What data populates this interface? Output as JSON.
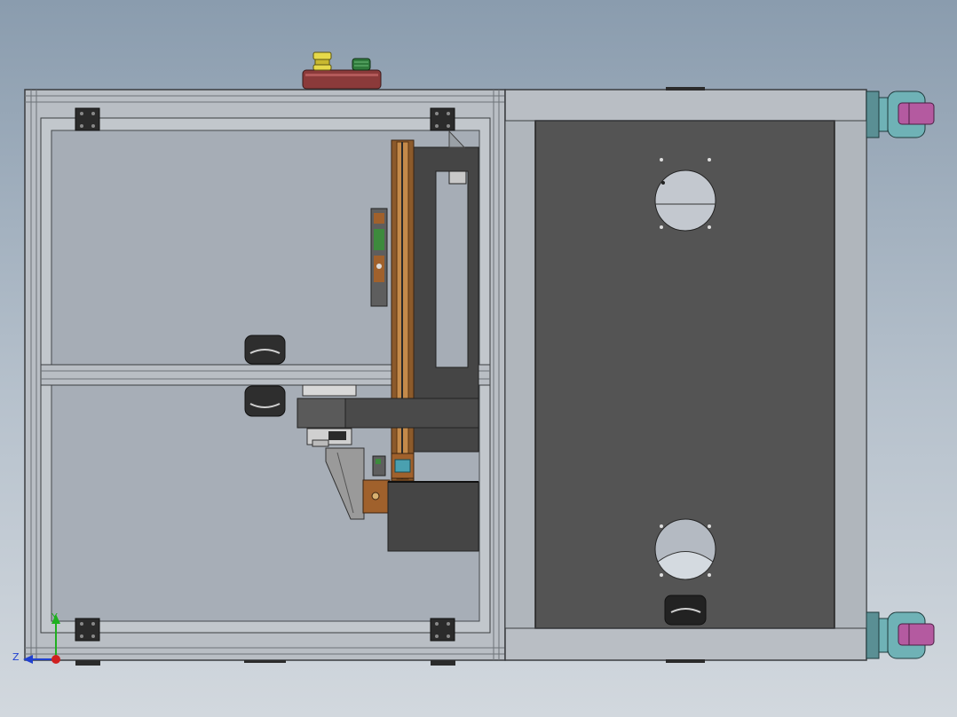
{
  "scene": {
    "view": "top",
    "colors": {
      "background_top": "#8a9cae",
      "background_bottom": "#d2d8de",
      "frame_aluminum": "#b9bec4",
      "frame_edge": "#3a3d40",
      "glass_panel": "#a6adb6",
      "dark_plate": "#545454",
      "control_box": "#8b3a3a",
      "estop_button": "#e0d23a",
      "start_button": "#2f7a3c",
      "wood_component": "#a0612c",
      "caster_body": "#6fb2b6",
      "caster_wheel": "#b45aa0",
      "axis_x": "#d02020",
      "axis_y": "#20b020",
      "axis_z": "#2040d0"
    },
    "components": [
      "aluminum-frame-enclosure",
      "control-box",
      "hinge",
      "guide-rail",
      "handle",
      "cutout-hole",
      "caster-wheel"
    ]
  },
  "triad": {
    "y_label": "Y",
    "z_label": "Z"
  }
}
